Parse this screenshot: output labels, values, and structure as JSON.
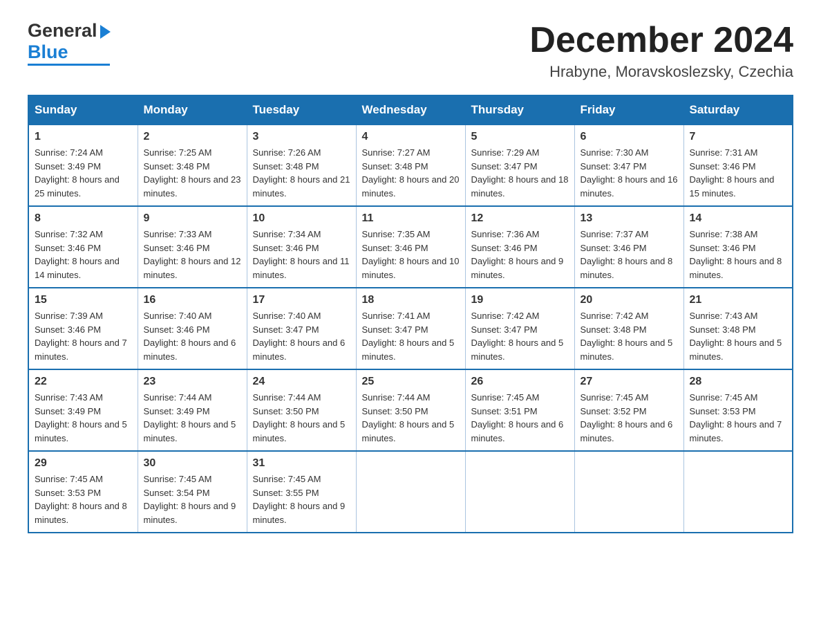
{
  "header": {
    "logo_general": "General",
    "logo_blue": "Blue",
    "main_title": "December 2024",
    "subtitle": "Hrabyne, Moravskoslezsky, Czechia"
  },
  "calendar": {
    "days_of_week": [
      "Sunday",
      "Monday",
      "Tuesday",
      "Wednesday",
      "Thursday",
      "Friday",
      "Saturday"
    ],
    "weeks": [
      [
        {
          "day": "1",
          "sunrise": "Sunrise: 7:24 AM",
          "sunset": "Sunset: 3:49 PM",
          "daylight": "Daylight: 8 hours and 25 minutes."
        },
        {
          "day": "2",
          "sunrise": "Sunrise: 7:25 AM",
          "sunset": "Sunset: 3:48 PM",
          "daylight": "Daylight: 8 hours and 23 minutes."
        },
        {
          "day": "3",
          "sunrise": "Sunrise: 7:26 AM",
          "sunset": "Sunset: 3:48 PM",
          "daylight": "Daylight: 8 hours and 21 minutes."
        },
        {
          "day": "4",
          "sunrise": "Sunrise: 7:27 AM",
          "sunset": "Sunset: 3:48 PM",
          "daylight": "Daylight: 8 hours and 20 minutes."
        },
        {
          "day": "5",
          "sunrise": "Sunrise: 7:29 AM",
          "sunset": "Sunset: 3:47 PM",
          "daylight": "Daylight: 8 hours and 18 minutes."
        },
        {
          "day": "6",
          "sunrise": "Sunrise: 7:30 AM",
          "sunset": "Sunset: 3:47 PM",
          "daylight": "Daylight: 8 hours and 16 minutes."
        },
        {
          "day": "7",
          "sunrise": "Sunrise: 7:31 AM",
          "sunset": "Sunset: 3:46 PM",
          "daylight": "Daylight: 8 hours and 15 minutes."
        }
      ],
      [
        {
          "day": "8",
          "sunrise": "Sunrise: 7:32 AM",
          "sunset": "Sunset: 3:46 PM",
          "daylight": "Daylight: 8 hours and 14 minutes."
        },
        {
          "day": "9",
          "sunrise": "Sunrise: 7:33 AM",
          "sunset": "Sunset: 3:46 PM",
          "daylight": "Daylight: 8 hours and 12 minutes."
        },
        {
          "day": "10",
          "sunrise": "Sunrise: 7:34 AM",
          "sunset": "Sunset: 3:46 PM",
          "daylight": "Daylight: 8 hours and 11 minutes."
        },
        {
          "day": "11",
          "sunrise": "Sunrise: 7:35 AM",
          "sunset": "Sunset: 3:46 PM",
          "daylight": "Daylight: 8 hours and 10 minutes."
        },
        {
          "day": "12",
          "sunrise": "Sunrise: 7:36 AM",
          "sunset": "Sunset: 3:46 PM",
          "daylight": "Daylight: 8 hours and 9 minutes."
        },
        {
          "day": "13",
          "sunrise": "Sunrise: 7:37 AM",
          "sunset": "Sunset: 3:46 PM",
          "daylight": "Daylight: 8 hours and 8 minutes."
        },
        {
          "day": "14",
          "sunrise": "Sunrise: 7:38 AM",
          "sunset": "Sunset: 3:46 PM",
          "daylight": "Daylight: 8 hours and 8 minutes."
        }
      ],
      [
        {
          "day": "15",
          "sunrise": "Sunrise: 7:39 AM",
          "sunset": "Sunset: 3:46 PM",
          "daylight": "Daylight: 8 hours and 7 minutes."
        },
        {
          "day": "16",
          "sunrise": "Sunrise: 7:40 AM",
          "sunset": "Sunset: 3:46 PM",
          "daylight": "Daylight: 8 hours and 6 minutes."
        },
        {
          "day": "17",
          "sunrise": "Sunrise: 7:40 AM",
          "sunset": "Sunset: 3:47 PM",
          "daylight": "Daylight: 8 hours and 6 minutes."
        },
        {
          "day": "18",
          "sunrise": "Sunrise: 7:41 AM",
          "sunset": "Sunset: 3:47 PM",
          "daylight": "Daylight: 8 hours and 5 minutes."
        },
        {
          "day": "19",
          "sunrise": "Sunrise: 7:42 AM",
          "sunset": "Sunset: 3:47 PM",
          "daylight": "Daylight: 8 hours and 5 minutes."
        },
        {
          "day": "20",
          "sunrise": "Sunrise: 7:42 AM",
          "sunset": "Sunset: 3:48 PM",
          "daylight": "Daylight: 8 hours and 5 minutes."
        },
        {
          "day": "21",
          "sunrise": "Sunrise: 7:43 AM",
          "sunset": "Sunset: 3:48 PM",
          "daylight": "Daylight: 8 hours and 5 minutes."
        }
      ],
      [
        {
          "day": "22",
          "sunrise": "Sunrise: 7:43 AM",
          "sunset": "Sunset: 3:49 PM",
          "daylight": "Daylight: 8 hours and 5 minutes."
        },
        {
          "day": "23",
          "sunrise": "Sunrise: 7:44 AM",
          "sunset": "Sunset: 3:49 PM",
          "daylight": "Daylight: 8 hours and 5 minutes."
        },
        {
          "day": "24",
          "sunrise": "Sunrise: 7:44 AM",
          "sunset": "Sunset: 3:50 PM",
          "daylight": "Daylight: 8 hours and 5 minutes."
        },
        {
          "day": "25",
          "sunrise": "Sunrise: 7:44 AM",
          "sunset": "Sunset: 3:50 PM",
          "daylight": "Daylight: 8 hours and 5 minutes."
        },
        {
          "day": "26",
          "sunrise": "Sunrise: 7:45 AM",
          "sunset": "Sunset: 3:51 PM",
          "daylight": "Daylight: 8 hours and 6 minutes."
        },
        {
          "day": "27",
          "sunrise": "Sunrise: 7:45 AM",
          "sunset": "Sunset: 3:52 PM",
          "daylight": "Daylight: 8 hours and 6 minutes."
        },
        {
          "day": "28",
          "sunrise": "Sunrise: 7:45 AM",
          "sunset": "Sunset: 3:53 PM",
          "daylight": "Daylight: 8 hours and 7 minutes."
        }
      ],
      [
        {
          "day": "29",
          "sunrise": "Sunrise: 7:45 AM",
          "sunset": "Sunset: 3:53 PM",
          "daylight": "Daylight: 8 hours and 8 minutes."
        },
        {
          "day": "30",
          "sunrise": "Sunrise: 7:45 AM",
          "sunset": "Sunset: 3:54 PM",
          "daylight": "Daylight: 8 hours and 9 minutes."
        },
        {
          "day": "31",
          "sunrise": "Sunrise: 7:45 AM",
          "sunset": "Sunset: 3:55 PM",
          "daylight": "Daylight: 8 hours and 9 minutes."
        },
        null,
        null,
        null,
        null
      ]
    ]
  }
}
